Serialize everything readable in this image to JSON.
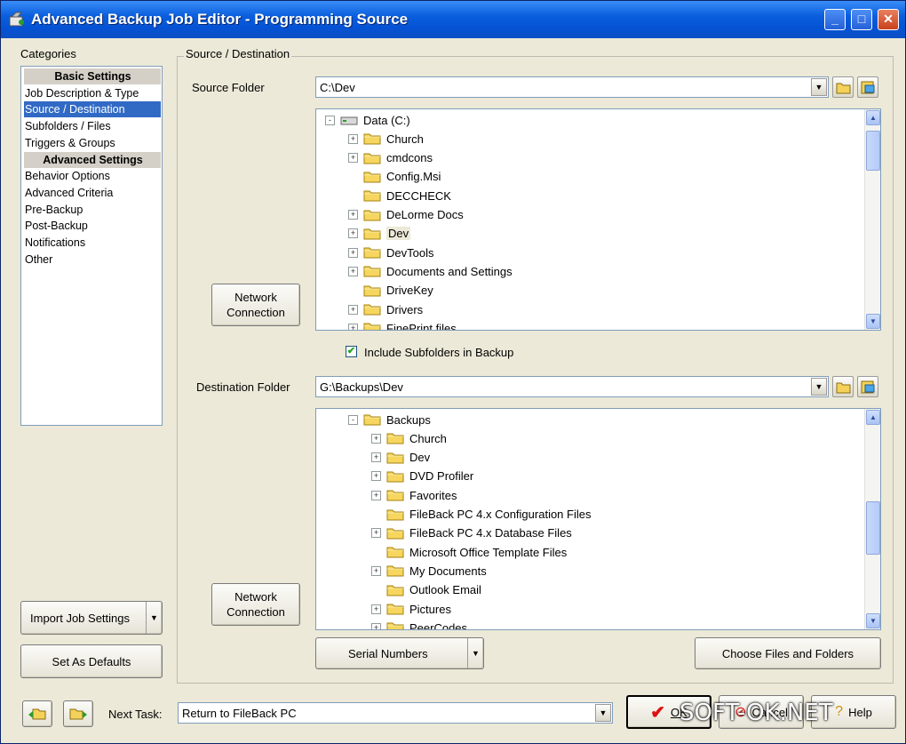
{
  "window": {
    "title": "Advanced Backup Job Editor - Programming Source",
    "controls": [
      "minimize-icon",
      "maximize-icon",
      "close-icon"
    ]
  },
  "categories": {
    "label": "Categories",
    "items": [
      {
        "label": "Basic Settings",
        "type": "header"
      },
      {
        "label": "Job Description & Type",
        "type": "item"
      },
      {
        "label": "Source / Destination",
        "type": "selected"
      },
      {
        "label": "Subfolders / Files",
        "type": "item"
      },
      {
        "label": "Triggers & Groups",
        "type": "item"
      },
      {
        "label": "Advanced Settings",
        "type": "header"
      },
      {
        "label": "Behavior Options",
        "type": "item"
      },
      {
        "label": "Advanced Criteria",
        "type": "item"
      },
      {
        "label": "Pre-Backup",
        "type": "item"
      },
      {
        "label": "Post-Backup",
        "type": "item"
      },
      {
        "label": "Notifications",
        "type": "item"
      },
      {
        "label": "Other",
        "type": "item"
      }
    ]
  },
  "left_buttons": {
    "import": "Import Job Settings",
    "defaults": "Set As Defaults"
  },
  "section": {
    "label": "Source / Destination",
    "source_label": "Source Folder",
    "source_value": "C:\\Dev",
    "source_tree": [
      {
        "label": "Data (C:)",
        "level": 0,
        "exp": "-",
        "icon": "drive"
      },
      {
        "label": "Church",
        "level": 1,
        "exp": "+"
      },
      {
        "label": "cmdcons",
        "level": 1,
        "exp": "+"
      },
      {
        "label": "Config.Msi",
        "level": 1,
        "exp": ""
      },
      {
        "label": "DECCHECK",
        "level": 1,
        "exp": ""
      },
      {
        "label": "DeLorme Docs",
        "level": 1,
        "exp": "+"
      },
      {
        "label": "Dev",
        "level": 1,
        "exp": "+",
        "selected": true
      },
      {
        "label": "DevTools",
        "level": 1,
        "exp": "+"
      },
      {
        "label": "Documents and Settings",
        "level": 1,
        "exp": "+"
      },
      {
        "label": "DriveKey",
        "level": 1,
        "exp": ""
      },
      {
        "label": "Drivers",
        "level": 1,
        "exp": "+"
      },
      {
        "label": "FinePrint files",
        "level": 1,
        "exp": "+"
      }
    ],
    "network_button": "Network Connection",
    "include_subfolders_label": "Include Subfolders in Backup",
    "include_subfolders_checked": true,
    "dest_label": "Destination Folder",
    "dest_value": "G:\\Backups\\Dev",
    "dest_tree": [
      {
        "label": "Backups",
        "level": 1,
        "exp": "-"
      },
      {
        "label": "Church",
        "level": 2,
        "exp": "+"
      },
      {
        "label": "Dev",
        "level": 2,
        "exp": "+"
      },
      {
        "label": "DVD Profiler",
        "level": 2,
        "exp": "+"
      },
      {
        "label": "Favorites",
        "level": 2,
        "exp": "+"
      },
      {
        "label": "FileBack PC 4.x Configuration Files",
        "level": 2,
        "exp": ""
      },
      {
        "label": "FileBack PC 4.x Database Files",
        "level": 2,
        "exp": "+"
      },
      {
        "label": "Microsoft Office Template Files",
        "level": 2,
        "exp": ""
      },
      {
        "label": "My Documents",
        "level": 2,
        "exp": "+"
      },
      {
        "label": "Outlook Email",
        "level": 2,
        "exp": ""
      },
      {
        "label": "Pictures",
        "level": 2,
        "exp": "+"
      },
      {
        "label": "PeerCodes",
        "level": 2,
        "exp": "+"
      }
    ],
    "serial_button": "Serial Numbers",
    "choose_button": "Choose Files and Folders"
  },
  "footer": {
    "next_task_label": "Next Task:",
    "next_task_value": "Return to FileBack PC",
    "ok": "OK",
    "cancel": "Cancel",
    "help": "Help"
  },
  "watermark": "SOFT-OK.NET"
}
